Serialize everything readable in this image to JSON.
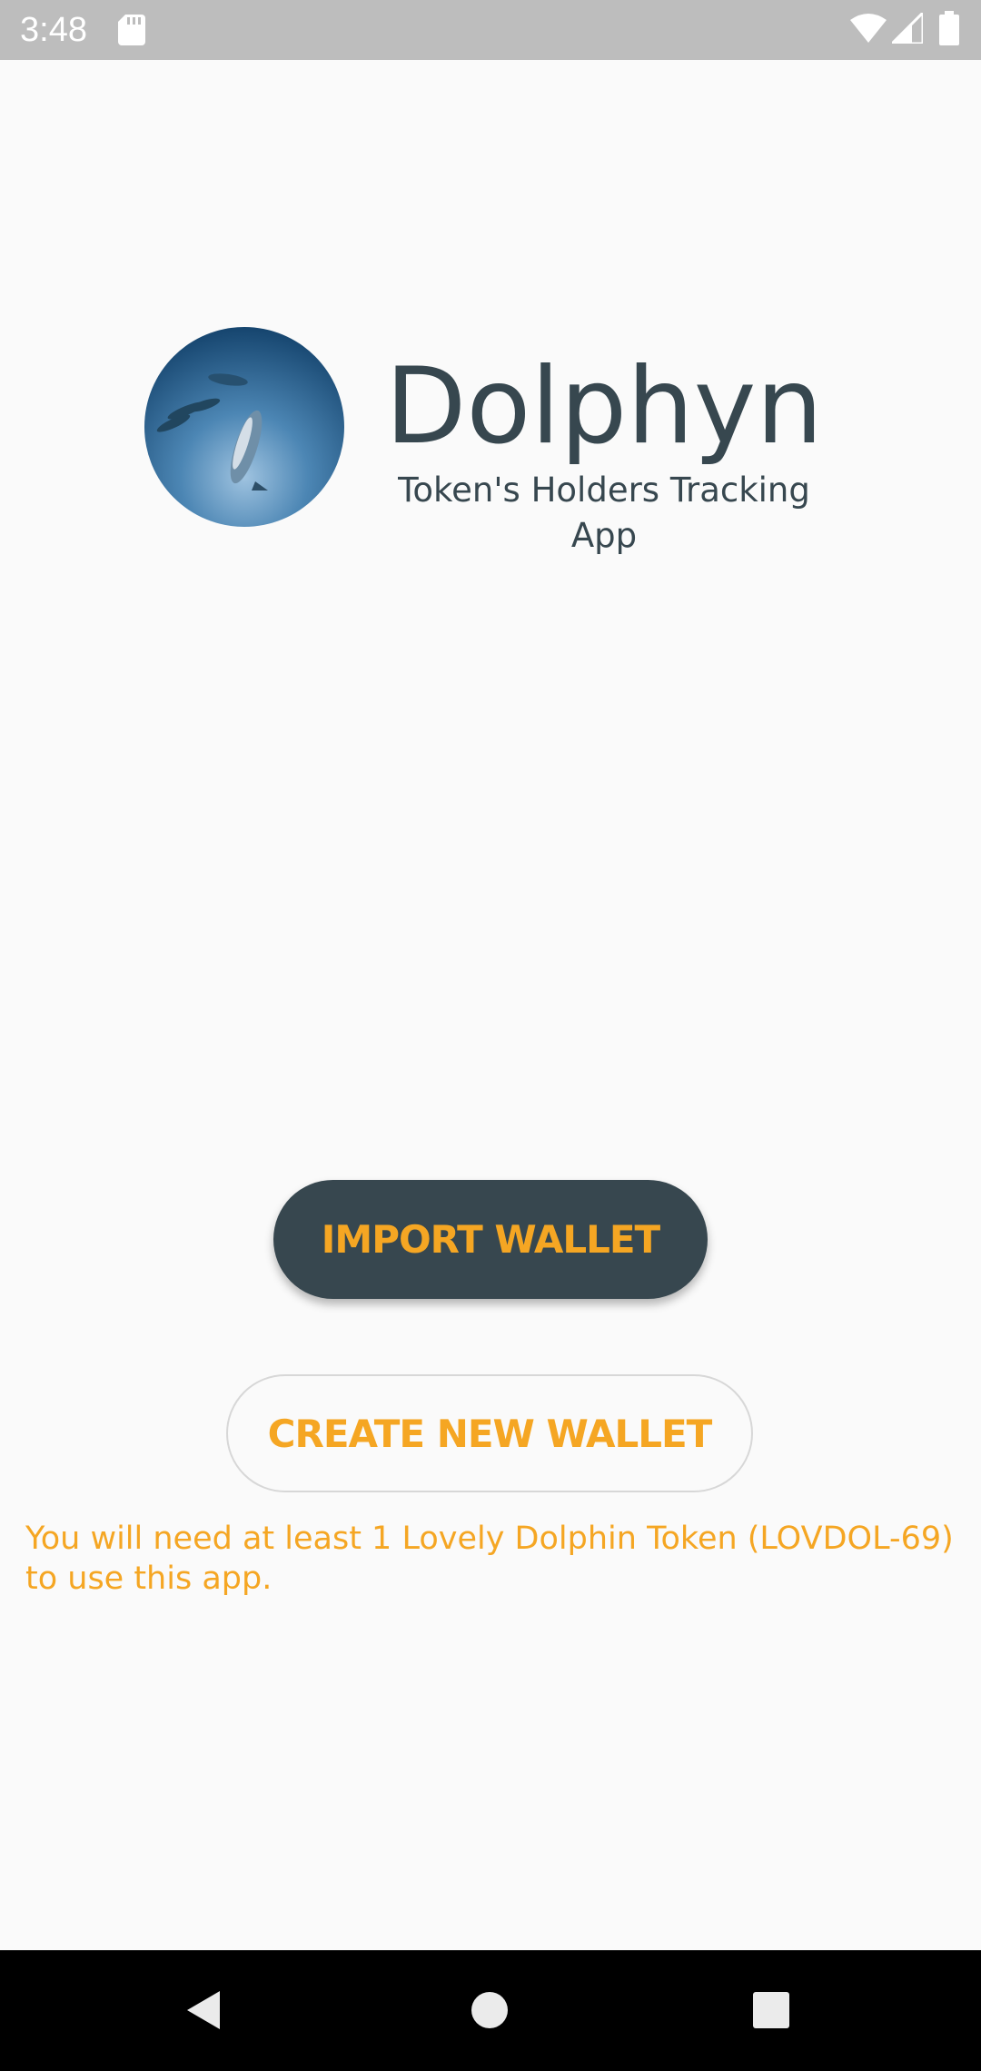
{
  "status_bar": {
    "time": "3:48",
    "icons": [
      "sd-card-icon",
      "wifi-icon",
      "signal-icon",
      "battery-icon"
    ]
  },
  "header": {
    "title": "Dolphyn",
    "subtitle": "Token's Holders Tracking App",
    "logo_icon": "dolphin-logo-image"
  },
  "actions": {
    "import_label": "IMPORT WALLET",
    "create_label": "CREATE NEW WALLET"
  },
  "notice": {
    "text": "You will need at least 1 Lovely Dolphin Token (LOVDOL-69) to use this app."
  },
  "nav_bar": {
    "icons": [
      "back-icon",
      "home-icon",
      "recents-icon"
    ]
  },
  "colors": {
    "background": "#fafafa",
    "primary_dark": "#37474f",
    "accent": "#f5a623",
    "status_bar": "#bdbdbd",
    "nav_bar": "#000000"
  }
}
